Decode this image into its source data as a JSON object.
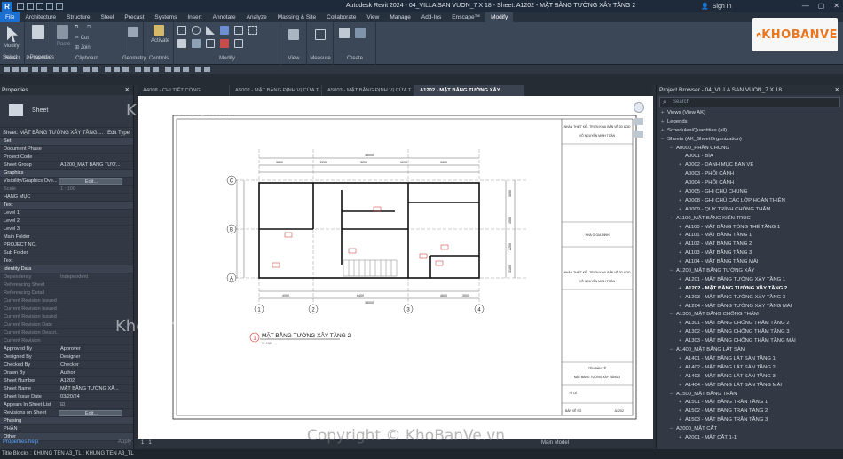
{
  "app": {
    "title": "Autodesk Revit 2024 - 04_VILLA SAN VUON_7 X 18 - Sheet: A1202 - MẶT BẰNG TƯỜNG XÂY TẦNG 2",
    "sign_in": "Sign In"
  },
  "ribbon_tabs": [
    "File",
    "Architecture",
    "Structure",
    "Steel",
    "Precast",
    "Systems",
    "Insert",
    "Annotate",
    "Analyze",
    "Massing & Site",
    "Collaborate",
    "View",
    "Manage",
    "Add-Ins",
    "Enscape™",
    "Modify"
  ],
  "ribbon": {
    "modify": "Modify",
    "paste": "Paste",
    "cut": "Cut",
    "join": "Join",
    "activate": "Activate",
    "panels": [
      "Select",
      "Properties",
      "Clipboard",
      "Geometry",
      "Controls",
      "Modify",
      "View",
      "Measure",
      "Create"
    ]
  },
  "select_bar": {
    "label": "Select",
    "properties": "Properties"
  },
  "logo": {
    "text": "KHOBANVE",
    "colors": {
      "orange": "#e87722"
    }
  },
  "properties": {
    "header": "Properties",
    "type_name": "Sheet",
    "type_selector": "Sheet: MẶT BẰNG TƯỜNG XÂY TẦNG ...",
    "edit_type": "Edit Type",
    "rows": [
      {
        "k": "Set",
        "group": true
      },
      {
        "k": "Document Phase",
        "v": ""
      },
      {
        "k": "Project Code",
        "v": ""
      },
      {
        "k": "Sheet Group",
        "v": "A1200_MẶT BẰNG TƯỜ..."
      },
      {
        "k": "Graphics",
        "group": true
      },
      {
        "k": "Visibility/Graphics Ove...",
        "v": "Edit...",
        "btn": true
      },
      {
        "k": "Scale",
        "v": "1 : 100",
        "dim": true
      },
      {
        "k": "HẠNG MỤC",
        "v": ""
      },
      {
        "k": "Text",
        "group": true
      },
      {
        "k": "Level 1",
        "v": ""
      },
      {
        "k": "Level 2",
        "v": ""
      },
      {
        "k": "Level 3",
        "v": ""
      },
      {
        "k": "Main Folder",
        "v": ""
      },
      {
        "k": "PROJECT NO.",
        "v": ""
      },
      {
        "k": "Sub Folder",
        "v": ""
      },
      {
        "k": "Text",
        "v": ""
      },
      {
        "k": "Identity Data",
        "group": true
      },
      {
        "k": "Dependency",
        "v": "Independent",
        "dim": true
      },
      {
        "k": "Referencing Sheet",
        "v": "",
        "dim": true
      },
      {
        "k": "Referencing Detail",
        "v": "",
        "dim": true
      },
      {
        "k": "Current Revision Issued",
        "v": "",
        "dim": true
      },
      {
        "k": "Current Revision Issued ...",
        "v": "",
        "dim": true
      },
      {
        "k": "Current Revision Issued ...",
        "v": "",
        "dim": true
      },
      {
        "k": "Current Revision Date",
        "v": "",
        "dim": true
      },
      {
        "k": "Current Revision Descri...",
        "v": "",
        "dim": true
      },
      {
        "k": "Current Revision",
        "v": "",
        "dim": true
      },
      {
        "k": "Approved By",
        "v": "Approver"
      },
      {
        "k": "Designed By",
        "v": "Designer"
      },
      {
        "k": "Checked By",
        "v": "Checker"
      },
      {
        "k": "Drawn By",
        "v": "Author"
      },
      {
        "k": "Sheet Number",
        "v": "A1202"
      },
      {
        "k": "Sheet Name",
        "v": "MẶT BẰNG TƯỜNG XÂ..."
      },
      {
        "k": "Sheet Issue Date",
        "v": "03/20/24"
      },
      {
        "k": "Appears In Sheet List",
        "v": "☑"
      },
      {
        "k": "Revisions on Sheet",
        "v": "Edit...",
        "btn": true
      },
      {
        "k": "Phasing",
        "group": true
      },
      {
        "k": "PHẦN",
        "v": ""
      },
      {
        "k": "Other",
        "group": true
      }
    ],
    "help": "Properties help",
    "apply": "Apply"
  },
  "view_tabs": [
    {
      "label": "A4008 - CHI TIẾT CỔNG",
      "active": false
    },
    {
      "label": "A5002 - MẶT BẰNG ĐỊNH VỊ CỬA T...",
      "active": false
    },
    {
      "label": "A5003 - MẶT BẰNG ĐỊNH VỊ CỬA T...",
      "active": false
    },
    {
      "label": "A1202 - MẶT BẰNG TƯỜNG XÂY...",
      "active": true
    }
  ],
  "drawing": {
    "view_title": "MẶT BẰNG TƯỜNG XÂY TẦNG 2",
    "view_number": "1",
    "scale": "1 : 100",
    "total_dim": "18000",
    "dims_bottom": [
      "4000",
      "6400",
      "4600",
      "3000"
    ],
    "dims_top": [
      "3800",
      "2200",
      "3200",
      "1200",
      "3400"
    ],
    "dims_right": [
      "3600",
      "4500",
      "2200",
      "3100"
    ],
    "grid_cols": [
      "1",
      "2",
      "3",
      "4"
    ],
    "grid_rows": [
      "A",
      "B",
      "C"
    ],
    "title_block": {
      "company": "NHÀN THIẾT KẾ - TRIỂN KHAI BẢN VẼ 2D & 3D",
      "designer": "VÕ NGUYỄN MINH TOÀN",
      "owner": "NHÀ Ở GIA ĐÌNH",
      "sheet_title_label": "TÊN BẢN VẼ",
      "sheet_title": "MẶT BẰNG TƯỜNG XÂY TẦNG 2",
      "scale_label": "TỶ LỆ",
      "sheet_no_label": "BẢN VẼ SỐ",
      "sheet_no": "A1202"
    }
  },
  "view_control": {
    "scale": "1 : 1",
    "model": "Main Model"
  },
  "browser": {
    "header": "Project Browser - 04_VILLA SAN VUON_7 X 18",
    "search_placeholder": "Search",
    "items": [
      {
        "t": "Views (View AK)",
        "d": 0,
        "tg": "+"
      },
      {
        "t": "Legends",
        "d": 0,
        "tg": "+"
      },
      {
        "t": "Schedules/Quantities (all)",
        "d": 0,
        "tg": "+"
      },
      {
        "t": "Sheets (AK_SheetOrganization)",
        "d": 0,
        "tg": "−"
      },
      {
        "t": "A0000_PHẦN CHUNG",
        "d": 1,
        "tg": "−"
      },
      {
        "t": "A0001 - BÌA",
        "d": 2,
        "tg": ""
      },
      {
        "t": "A0002 - DANH MỤC BẢN VẼ",
        "d": 2,
        "tg": "+"
      },
      {
        "t": "A0003 - PHỐI CẢNH",
        "d": 2,
        "tg": ""
      },
      {
        "t": "A0004 - PHỐI CẢNH",
        "d": 2,
        "tg": ""
      },
      {
        "t": "A0005 - GHI CHÚ CHUNG",
        "d": 2,
        "tg": "+"
      },
      {
        "t": "A0008 - GHI CHÚ CÁC LỚP HOÀN THIỆN",
        "d": 2,
        "tg": "+"
      },
      {
        "t": "A0009 - QUY TRÌNH CHỐNG THẤM",
        "d": 2,
        "tg": "+"
      },
      {
        "t": "A1100_MẶT BẰNG KIẾN TRÚC",
        "d": 1,
        "tg": "−"
      },
      {
        "t": "A1100 - MẶT BẰNG TỔNG THỂ TẦNG 1",
        "d": 2,
        "tg": "+"
      },
      {
        "t": "A1101 - MẶT BẰNG TẦNG 1",
        "d": 2,
        "tg": "+"
      },
      {
        "t": "A1102 - MẶT BẰNG TẦNG 2",
        "d": 2,
        "tg": "+"
      },
      {
        "t": "A1103 - MẶT BẰNG TẦNG 3",
        "d": 2,
        "tg": "+"
      },
      {
        "t": "A1104 - MẶT BẰNG TẦNG MÁI",
        "d": 2,
        "tg": "+"
      },
      {
        "t": "A1200_MẶT BẰNG TƯỜNG XÂY",
        "d": 1,
        "tg": "−"
      },
      {
        "t": "A1201 - MẶT BẰNG TƯỜNG XÂY TẦNG 1",
        "d": 2,
        "tg": "+"
      },
      {
        "t": "A1202 - MẶT BẰNG TƯỜNG XÂY TẦNG 2",
        "d": 2,
        "tg": "+",
        "bold": true
      },
      {
        "t": "A1203 - MẶT BẰNG TƯỜNG XÂY TẦNG 3",
        "d": 2,
        "tg": "+"
      },
      {
        "t": "A1204 - MẶT BẰNG TƯỜNG XÂY TẦNG MÁI",
        "d": 2,
        "tg": "+"
      },
      {
        "t": "A1300_MẶT BẰNG CHỐNG THẤM",
        "d": 1,
        "tg": "−"
      },
      {
        "t": "A1301 - MẶT BẰNG CHỐNG THẤM TẦNG 2",
        "d": 2,
        "tg": "+"
      },
      {
        "t": "A1302 - MẶT BẰNG CHỐNG THẤM TẦNG 3",
        "d": 2,
        "tg": "+"
      },
      {
        "t": "A1303 - MẶT BẰNG CHỐNG THẤM TẦNG MÁI",
        "d": 2,
        "tg": "+"
      },
      {
        "t": "A1400_MẶT BẰNG LÁT SÀN",
        "d": 1,
        "tg": "−"
      },
      {
        "t": "A1401 - MẶT BẰNG LÁT SÀN TẦNG 1",
        "d": 2,
        "tg": "+"
      },
      {
        "t": "A1402 - MẶT BẰNG LÁT SÀN TẦNG 2",
        "d": 2,
        "tg": "+"
      },
      {
        "t": "A1403 - MẶT BẰNG LÁT SÀN TẦNG 3",
        "d": 2,
        "tg": "+"
      },
      {
        "t": "A1404 - MẶT BẰNG LÁT SÀN TẦNG MÁI",
        "d": 2,
        "tg": "+"
      },
      {
        "t": "A1500_MẶT BẰNG TRẦN",
        "d": 1,
        "tg": "−"
      },
      {
        "t": "A1501 - MẶT BẰNG TRẦN TẦNG 1",
        "d": 2,
        "tg": "+"
      },
      {
        "t": "A1502 - MẶT BẰNG TRẦN TẦNG 2",
        "d": 2,
        "tg": "+"
      },
      {
        "t": "A1503 - MẶT BẰNG TRẦN TẦNG 3",
        "d": 2,
        "tg": "+"
      },
      {
        "t": "A2000_MẶT CẮT",
        "d": 1,
        "tg": "−"
      },
      {
        "t": "A2001 - MẶT CẮT 1-1",
        "d": 2,
        "tg": "+"
      }
    ]
  },
  "status": {
    "text": "Title Blocks : KHUNG TEN A3_TL : KHUNG TEN A3_TL"
  },
  "watermarks": {
    "a": "KhoBanVe.vn",
    "b": "KhoBanVe.vn",
    "c": "Copyright © KhoBanVe.vn"
  }
}
